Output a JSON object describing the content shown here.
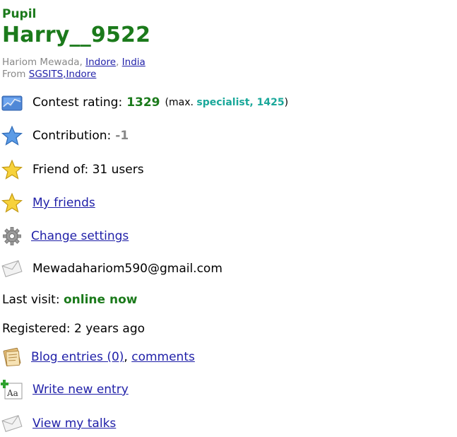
{
  "profile": {
    "rank": "Pupil",
    "handle": "Harry__9522",
    "name": "Hariom Mewada",
    "city": "Indore",
    "country": "India",
    "from_label": "From",
    "organization": "SGSITS,Indore"
  },
  "info": {
    "rating_label": "Contest rating:",
    "rating_value": "1329",
    "rating_max_prefix": "(max.",
    "rating_max_rank": "specialist, 1425",
    "rating_max_suffix": ")",
    "contribution_label": "Contribution:",
    "contribution_value": "-1",
    "friend_of": "Friend of: 31 users",
    "my_friends": "My friends",
    "change_settings": "Change settings",
    "email": "Mewadahariom590@gmail.com",
    "last_visit_label": "Last visit:",
    "last_visit_value": "online now",
    "registered": "Registered: 2 years ago",
    "blog_entries": "Blog entries (0)",
    "comments": "comments",
    "write_new_entry": "Write new entry",
    "view_my_talks": "View my talks"
  },
  "colors": {
    "rank_green": "#1b7a1b",
    "specialist": "#1aa89a",
    "link": "#1f1fa8"
  }
}
